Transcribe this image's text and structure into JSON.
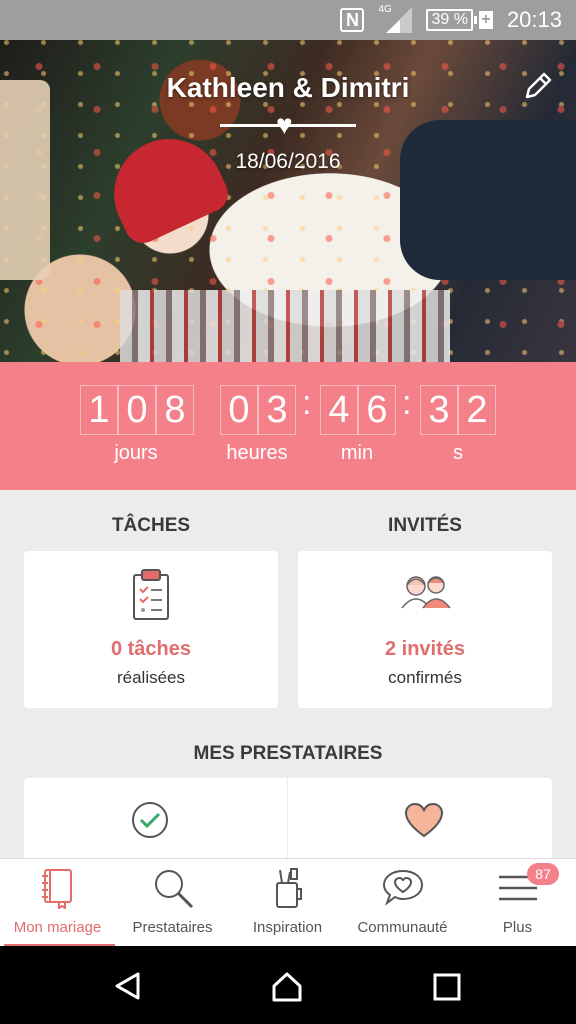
{
  "status_bar": {
    "network_label": "4G",
    "battery": "39 %",
    "time": "20:13"
  },
  "header": {
    "couple": "Kathleen & Dimitri",
    "date": "18/06/2016"
  },
  "countdown": {
    "days": [
      "1",
      "0",
      "8"
    ],
    "hours": [
      "0",
      "3"
    ],
    "minutes": [
      "4",
      "6"
    ],
    "seconds": [
      "3",
      "2"
    ],
    "labels": {
      "days": "jours",
      "hours": "heures",
      "minutes": "min",
      "seconds": "s"
    }
  },
  "tasks": {
    "title": "TÂCHES",
    "value": "0 tâches",
    "sub": "réalisées"
  },
  "guests": {
    "title": "INVITÉS",
    "value": "2 invités",
    "sub": "confirmés"
  },
  "vendors": {
    "title": "MES PRESTATAIRES"
  },
  "bottom_nav": {
    "items": [
      {
        "label": "Mon mariage",
        "icon": "notebook-icon"
      },
      {
        "label": "Prestataires",
        "icon": "search-icon"
      },
      {
        "label": "Inspiration",
        "icon": "pencil-cup-icon"
      },
      {
        "label": "Communauté",
        "icon": "chat-heart-icon"
      },
      {
        "label": "Plus",
        "icon": "menu-icon"
      }
    ],
    "badge": "87"
  },
  "colors": {
    "accent": "#f4808a",
    "accent_text": "#e26d6d"
  }
}
